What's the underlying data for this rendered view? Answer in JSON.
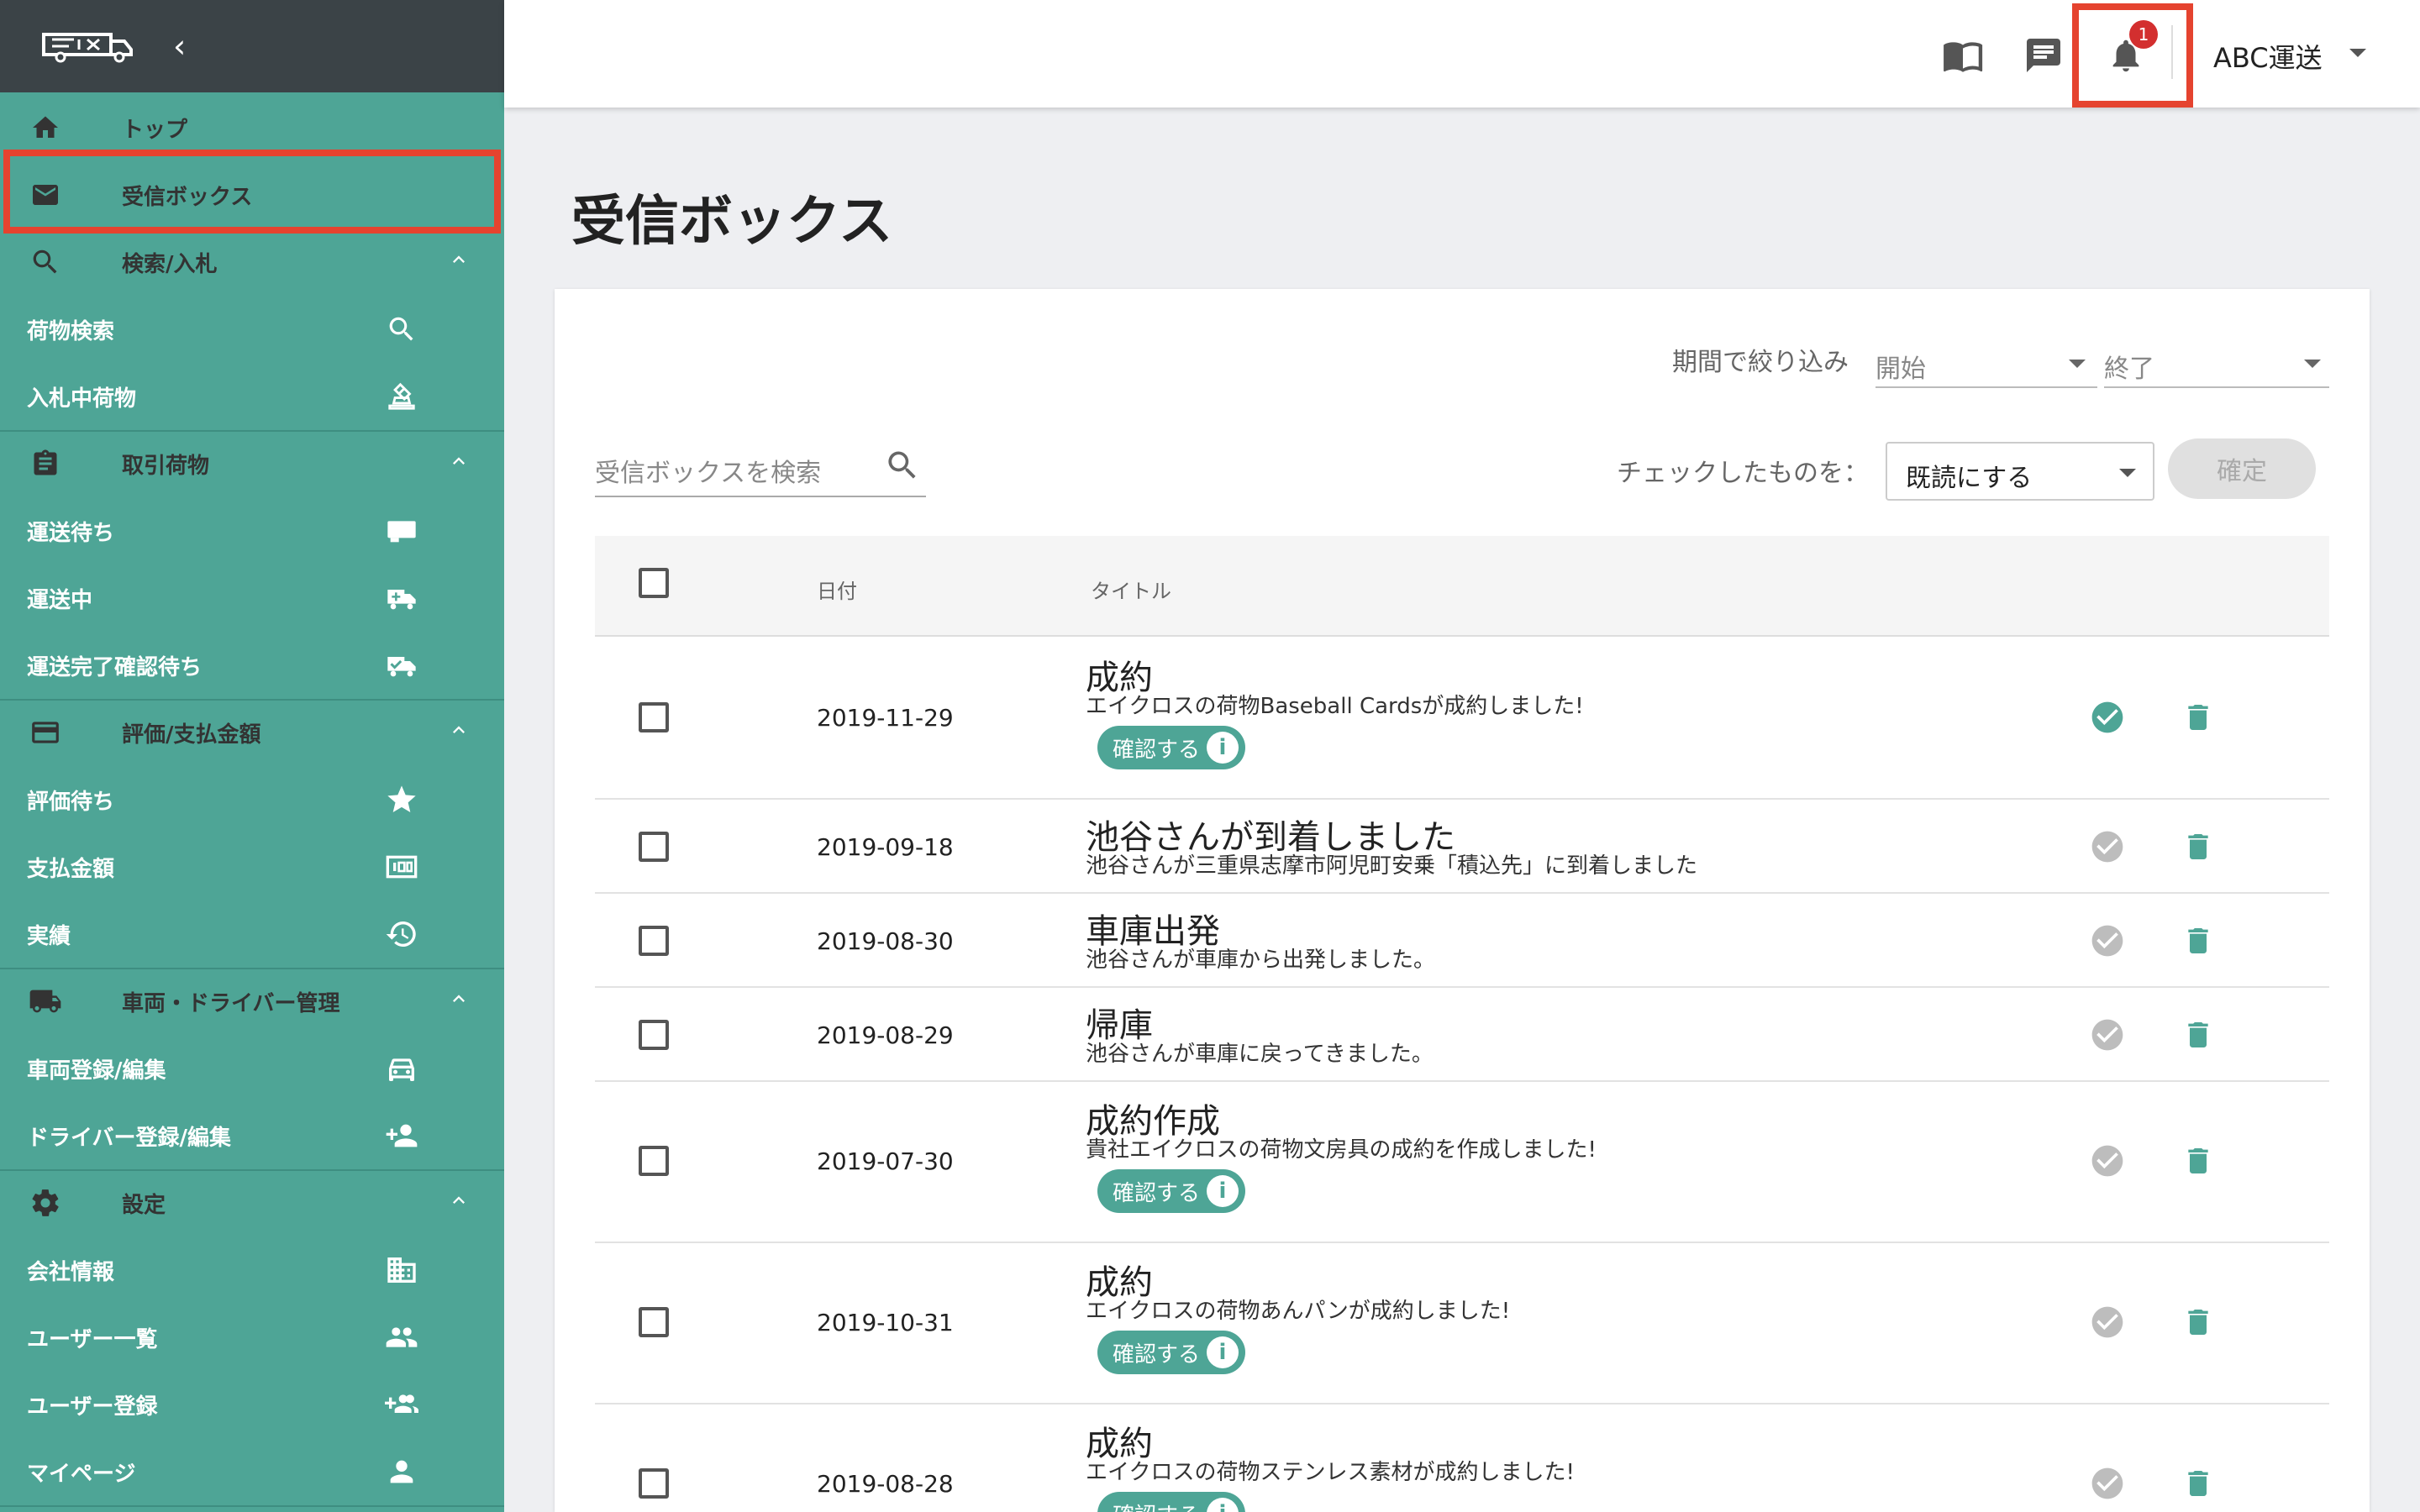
{
  "sidebar": {
    "collapse_glyph": "‹",
    "top": "トップ",
    "inbox": "受信ボックス",
    "search_bid": "検索/入札",
    "cargo_search": "荷物検索",
    "bidding_cargo": "入札中荷物",
    "trade_cargo": "取引荷物",
    "waiting_transport": "運送待ち",
    "in_transport": "運送中",
    "waiting_confirm": "運送完了確認待ち",
    "rating_payment": "評価/支払金額",
    "waiting_rating": "評価待ち",
    "payment_amount": "支払金額",
    "results": "実績",
    "vehicle_driver": "車両・ドライバー管理",
    "vehicle_edit": "車両登録/編集",
    "driver_edit": "ドライバー登録/編集",
    "settings": "設定",
    "company_info": "会社情報",
    "user_list": "ユーザー一覧",
    "user_register": "ユーザー登録",
    "my_page": "マイページ",
    "chevron": "⌃"
  },
  "topbar": {
    "badge_count": "1",
    "company": "ABC運送"
  },
  "main": {
    "page_title": "受信ボックス",
    "filter_label": "期間で絞り込み",
    "filter_start": "開始",
    "filter_end": "終了",
    "search_placeholder": "受信ボックスを検索",
    "check_label": "チェックしたものを：",
    "action_value": "既読にする",
    "confirm_button": "確定",
    "col_date": "日付",
    "col_title": "タイトル",
    "confirm_pill": "確認する",
    "info_glyph": "i"
  },
  "rows": [
    {
      "date": "2019-11-29",
      "title": "成約",
      "desc": "エイクロスの荷物Baseball Cardsが成約しました!",
      "read": true
    },
    {
      "date": "2019-09-18",
      "title": "池谷さんが到着しました",
      "desc": "池谷さんが三重県志摩市阿児町安乗「積込先」に到着しました",
      "read": false
    },
    {
      "date": "2019-08-30",
      "title": "車庫出発",
      "desc": "池谷さんが車庫から出発しました。",
      "read": false
    },
    {
      "date": "2019-08-29",
      "title": "帰庫",
      "desc": "池谷さんが車庫に戻ってきました。",
      "read": false
    },
    {
      "date": "2019-07-30",
      "title": "成約作成",
      "desc": "貴社エイクロスの荷物文房具の成約を作成しました!",
      "read": false
    },
    {
      "date": "2019-10-31",
      "title": "成約",
      "desc": "エイクロスの荷物あんパンが成約しました!",
      "read": false
    },
    {
      "date": "2019-08-28",
      "title": "成約",
      "desc": "エイクロスの荷物ステンレス素材が成約しました!",
      "read": false
    }
  ],
  "colors": {
    "accent": "#4ea596",
    "sidebar_header": "#3b4347",
    "highlight": "#e5432f",
    "read_check": "#4ea596",
    "unread_check": "#bdbdbd"
  }
}
